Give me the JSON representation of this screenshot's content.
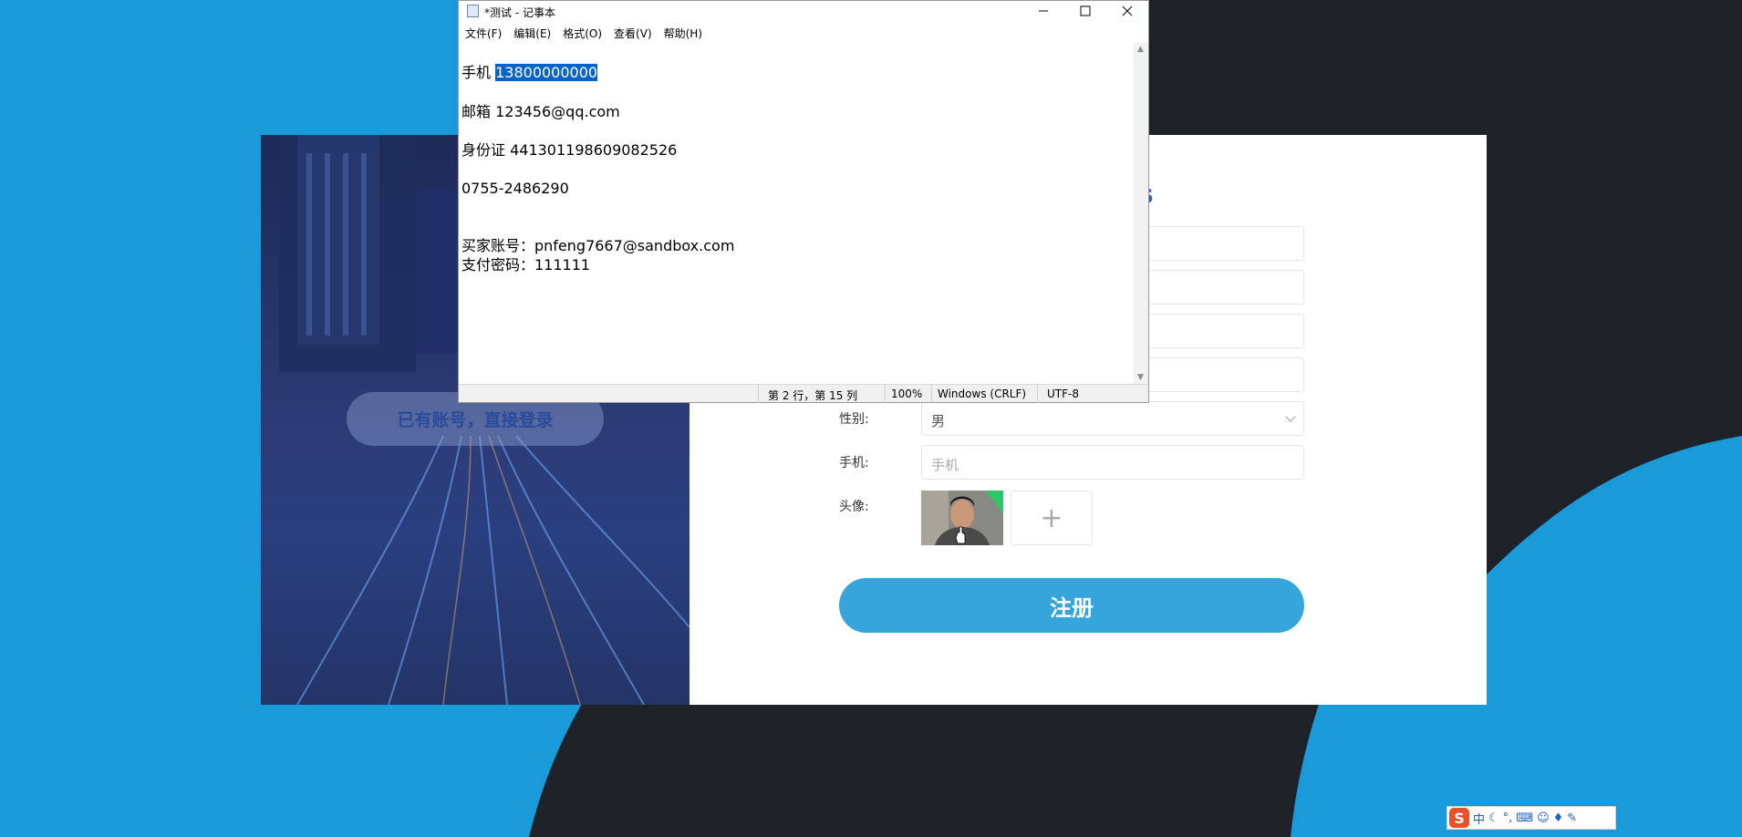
{
  "notepad": {
    "title": "*测试 - 记事本",
    "menu": [
      "文件(F)",
      "编辑(E)",
      "格式(O)",
      "查看(V)",
      "帮助(H)"
    ],
    "lines": [
      {
        "label": "手机 ",
        "value": "13800000000"
      },
      {
        "text": "邮箱 123456@qq.com"
      },
      {
        "text": "身份证 441301198609082526"
      },
      {
        "text": "0755-2486290"
      },
      {
        "text": "买家账号：pnfeng7667@sandbox.com"
      },
      {
        "text": "支付密码：111111"
      }
    ],
    "status": {
      "position": "第 2 行，第 15 列",
      "zoom": "100%",
      "line_ending": "Windows (CRLF)",
      "encoding": "UTF-8"
    }
  },
  "register": {
    "login_link": "已有账号，直接登录",
    "title_fragment": "s",
    "gender": {
      "label": "性别:",
      "value": "男"
    },
    "phone": {
      "label": "手机:",
      "placeholder": "手机"
    },
    "avatar": {
      "label": "头像:",
      "add": "+"
    },
    "submit": "注册"
  },
  "ime": {
    "logo": "S",
    "mode": "中"
  },
  "colors": {
    "background_blue": "#1a9ad8",
    "background_dark": "#1c2228",
    "button_blue": "#35a5db",
    "selection": "#0a64c8"
  }
}
